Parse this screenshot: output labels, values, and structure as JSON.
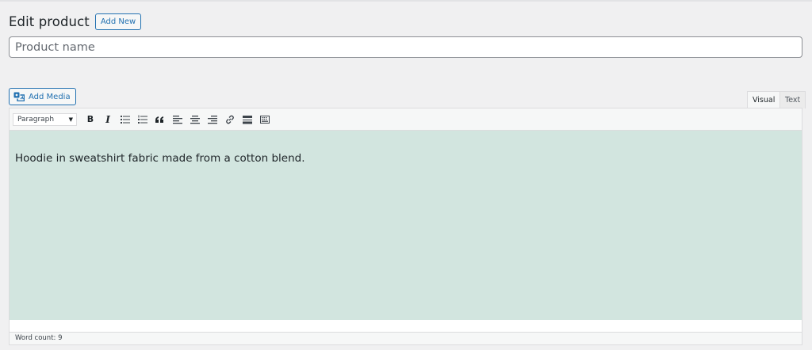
{
  "header": {
    "title": "Edit product",
    "add_new_label": "Add New"
  },
  "title_field": {
    "placeholder": "Product name",
    "value": ""
  },
  "editor": {
    "add_media_label": "Add Media",
    "tabs": [
      {
        "label": "Visual",
        "active": true
      },
      {
        "label": "Text",
        "active": false
      }
    ],
    "toolbar": {
      "format_select": "Paragraph",
      "buttons": [
        {
          "name": "bold",
          "label": "B"
        },
        {
          "name": "italic",
          "label": "I"
        },
        {
          "name": "bulleted-list"
        },
        {
          "name": "numbered-list"
        },
        {
          "name": "blockquote"
        },
        {
          "name": "align-left"
        },
        {
          "name": "align-center"
        },
        {
          "name": "align-right"
        },
        {
          "name": "insert-link"
        },
        {
          "name": "read-more"
        },
        {
          "name": "toolbar-toggle"
        }
      ]
    },
    "content": "Hoodie in sweatshirt fabric made from a cotton blend.",
    "content_bg": "#d2e5df",
    "word_count_text": "Word count: 9"
  },
  "colors": {
    "accent": "#2271b1",
    "page_bg": "#f0f0f1"
  }
}
